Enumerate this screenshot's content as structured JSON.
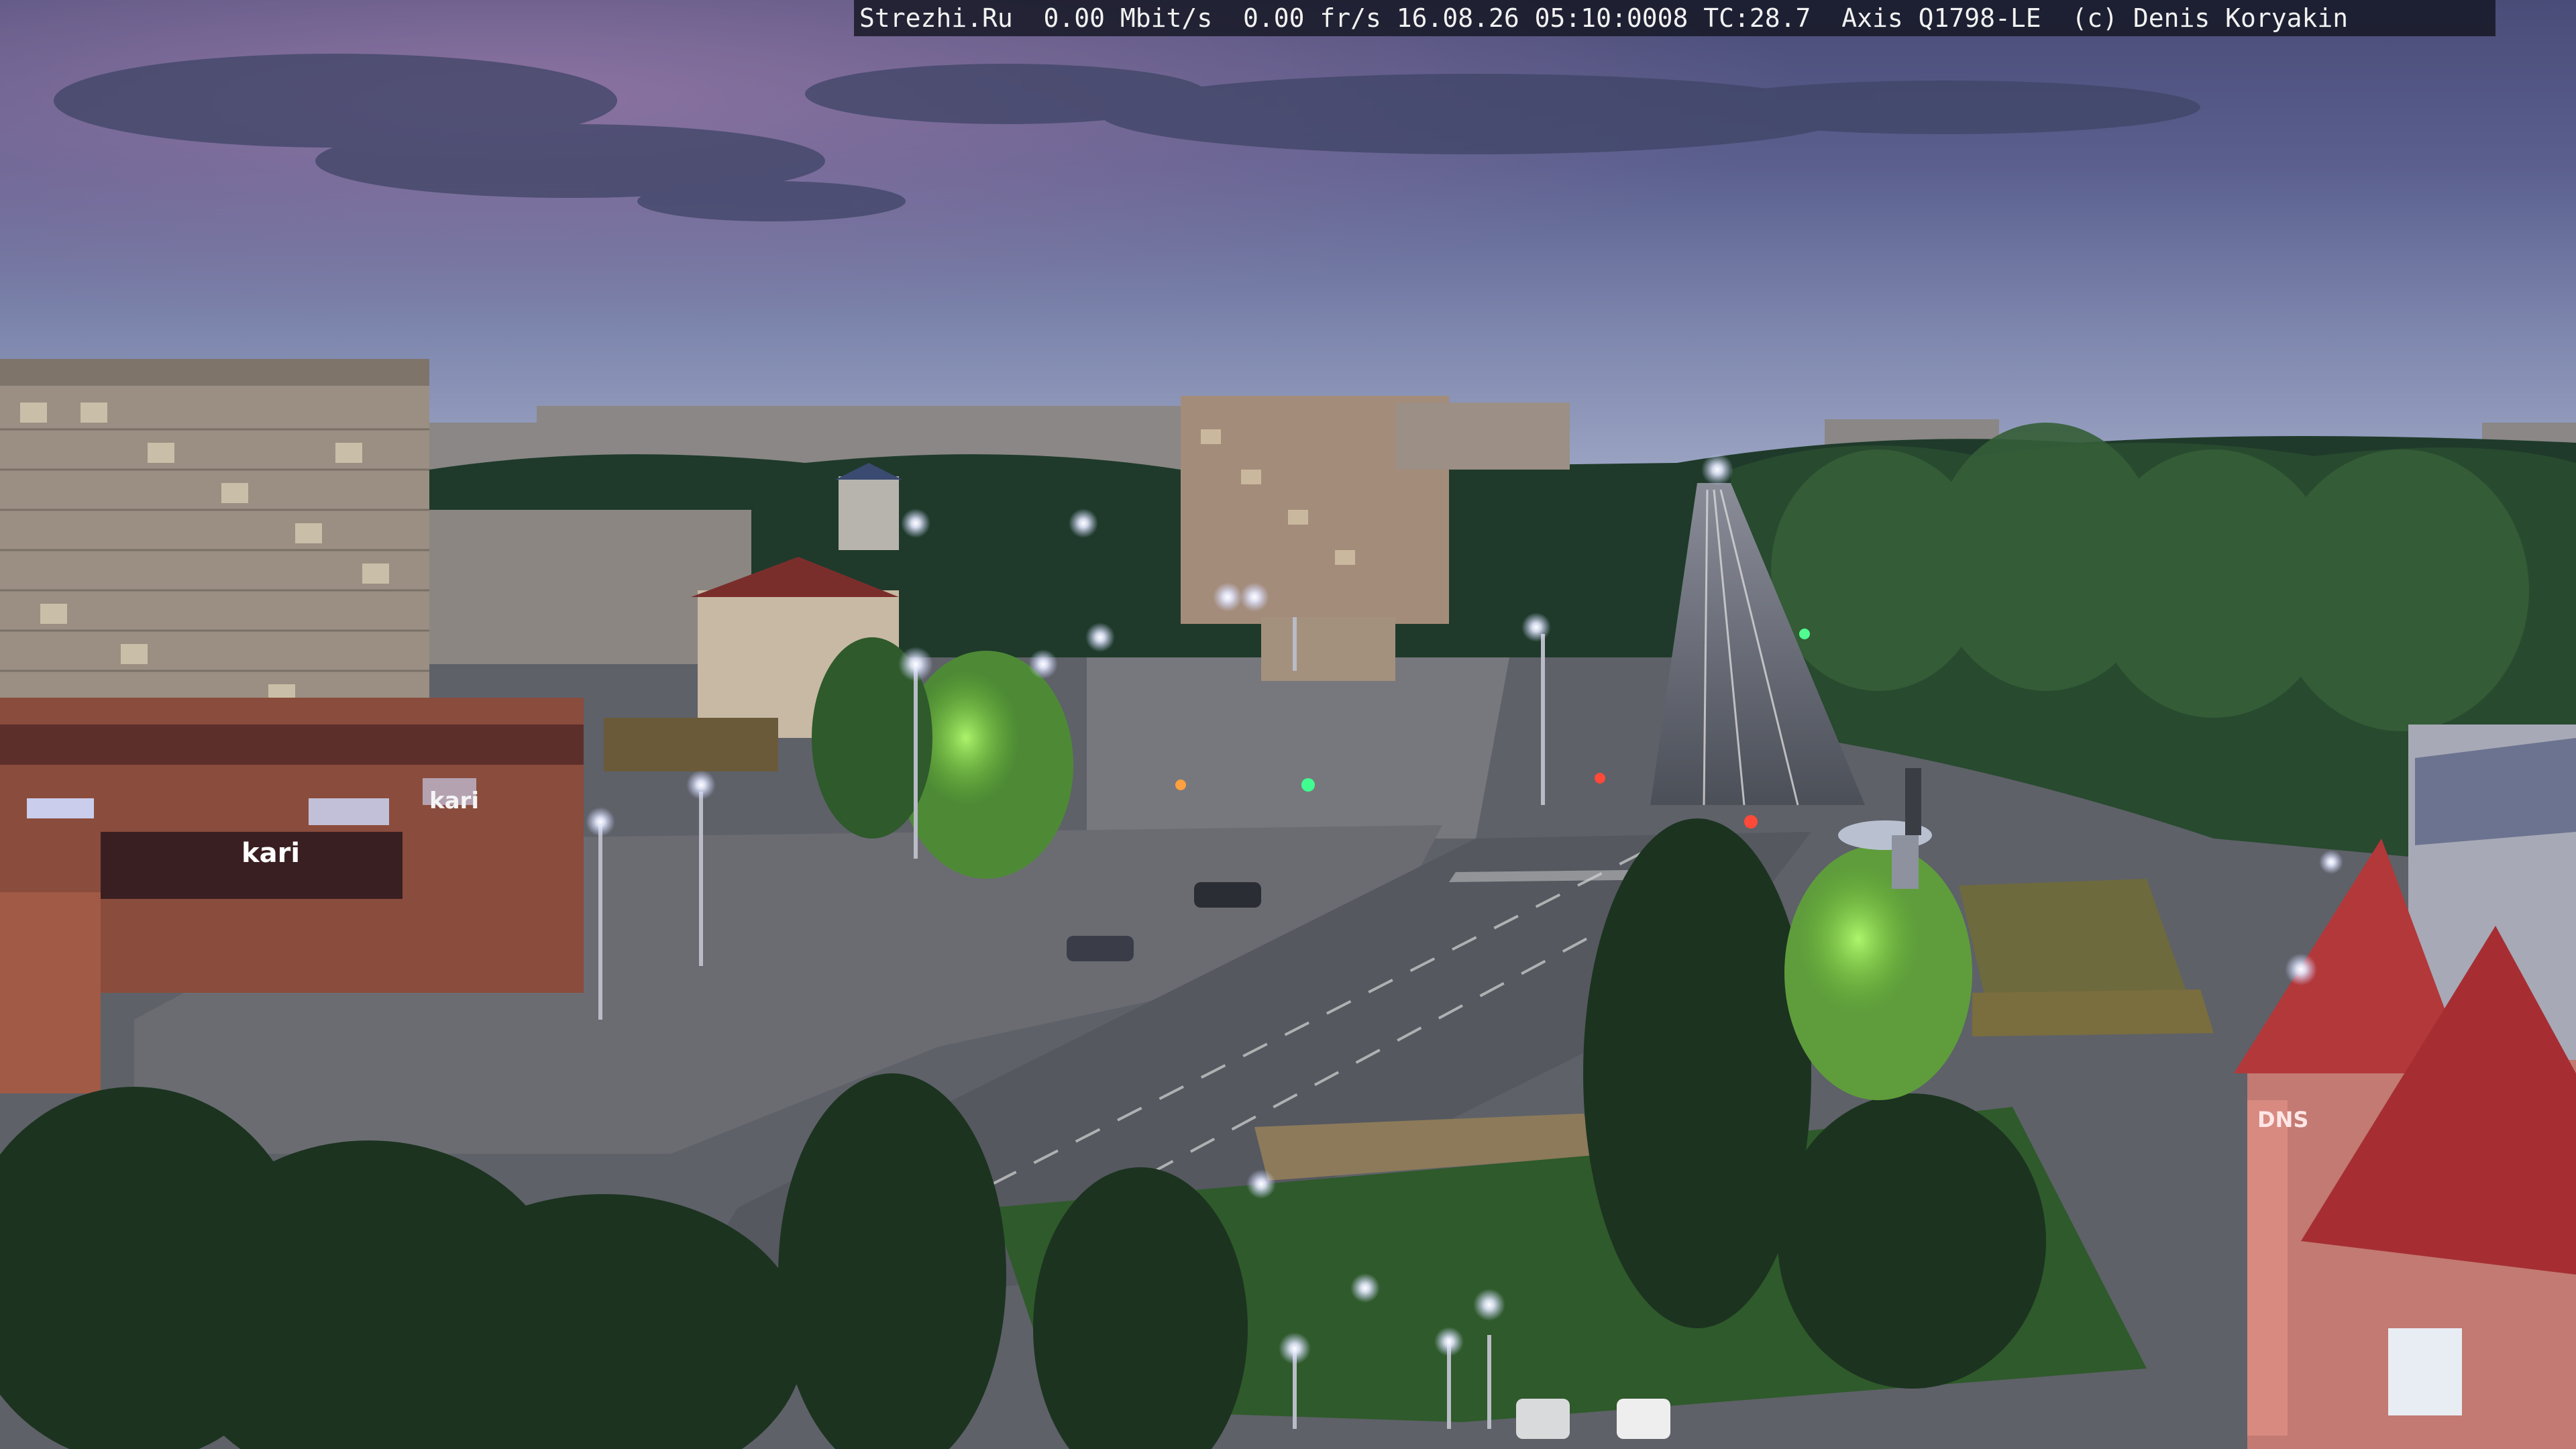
{
  "overlay": {
    "text": "Strezhi.Ru  0.00 Mbit/s  0.00 fr/s 16.08.26 05:10:0008 TC:28.7  Axis Q1798-LE  (c) Denis Koryakin"
  },
  "signs": {
    "store_left": "kari",
    "store_upper": "kari",
    "store_right": "DNS"
  }
}
